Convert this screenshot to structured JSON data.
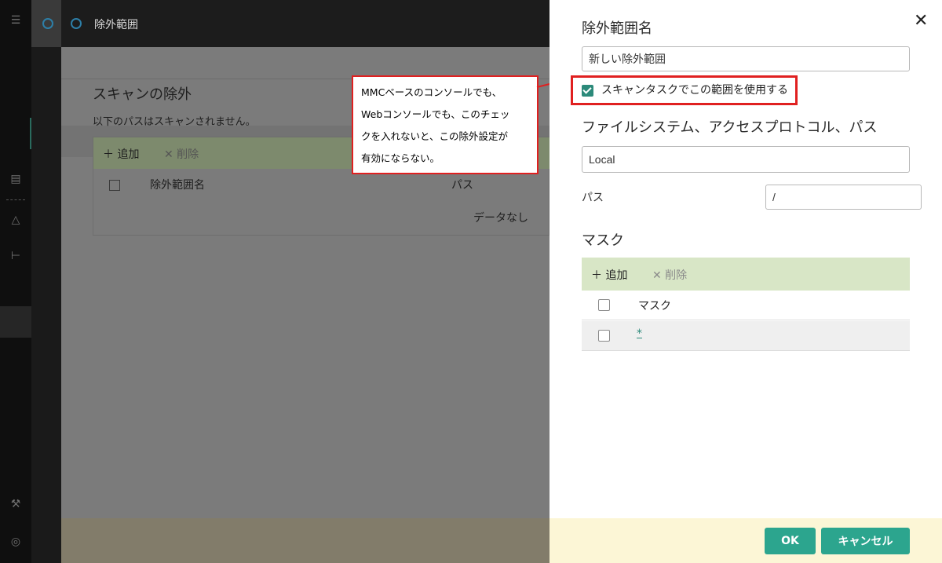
{
  "header": {
    "title": "除外範囲"
  },
  "background": {
    "heading": "スキャンの除外",
    "subtitle": "以下のパスはスキャンされません。",
    "toolbar": {
      "add_label": "＋ 追加",
      "delete_label": "✕ 削除"
    },
    "table": {
      "columns": [
        "除外範囲名",
        "パス"
      ],
      "empty_text": "データなし"
    }
  },
  "callout": {
    "text": "MMCベースのコンソールでも、\nWebコンソールでも、このチェッ\nクを入れないと、この除外設定が\n有効にならない。"
  },
  "panel": {
    "close_glyph": "✕",
    "name_label": "除外範囲名",
    "name_value": "新しい除外範囲",
    "use_checkbox": {
      "label": "スキャンタスクでこの範囲を使用する",
      "checked": true
    },
    "fs_label": "ファイルシステム、アクセスプロトコル、パス",
    "fs_value": "Local",
    "path_label": "パス",
    "path_value": "/",
    "mask_label": "マスク",
    "mask_toolbar": {
      "add_label": "＋ 追加",
      "delete_label": "✕ 削除"
    },
    "mask_table": {
      "column": "マスク",
      "rows": [
        {
          "value": "*"
        }
      ]
    },
    "ok_label": "OK",
    "cancel_label": "キャンセル"
  },
  "colors": {
    "accent": "#2ca58e",
    "highlight": "#e02020",
    "toolbar": "#d8e6c6",
    "footer": "#fcf6d6"
  },
  "icons": [
    "menu-icon",
    "circle-arrow-icon",
    "list-icon",
    "warning-icon",
    "tree-icon",
    "wrench-icon",
    "user-icon",
    "close-icon",
    "checkmark-icon"
  ]
}
